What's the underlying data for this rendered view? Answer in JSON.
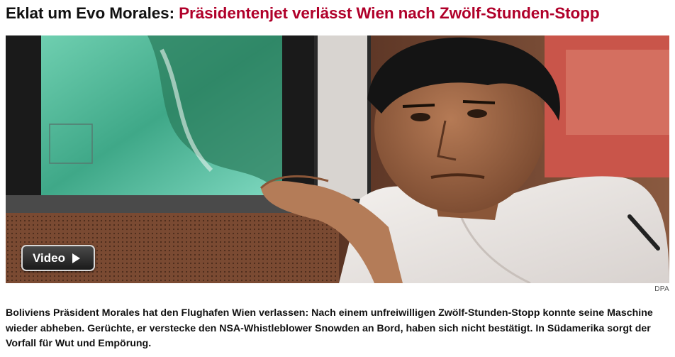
{
  "article": {
    "kicker": "Eklat um Evo Morales:",
    "title": "Präsidentenjet verlässt Wien nach Zwölf-Stunden-Stopp",
    "image": {
      "credit": "DPA",
      "video_label": "Video",
      "video_icon": "play-icon"
    },
    "teaser": "Boliviens Präsident Morales hat den Flughafen Wien verlassen: Nach einem unfreiwilligen Zwölf-Stunden-Stopp konnte seine Maschine wieder abheben. Gerüchte, er verstecke den NSA-Whistleblower Snowden an Bord, haben sich nicht bestätigt. In Südamerika sorgt der Vorfall für Wut und Empörung."
  },
  "colors": {
    "title": "#b0002a",
    "kicker": "#111111",
    "text": "#111111"
  }
}
